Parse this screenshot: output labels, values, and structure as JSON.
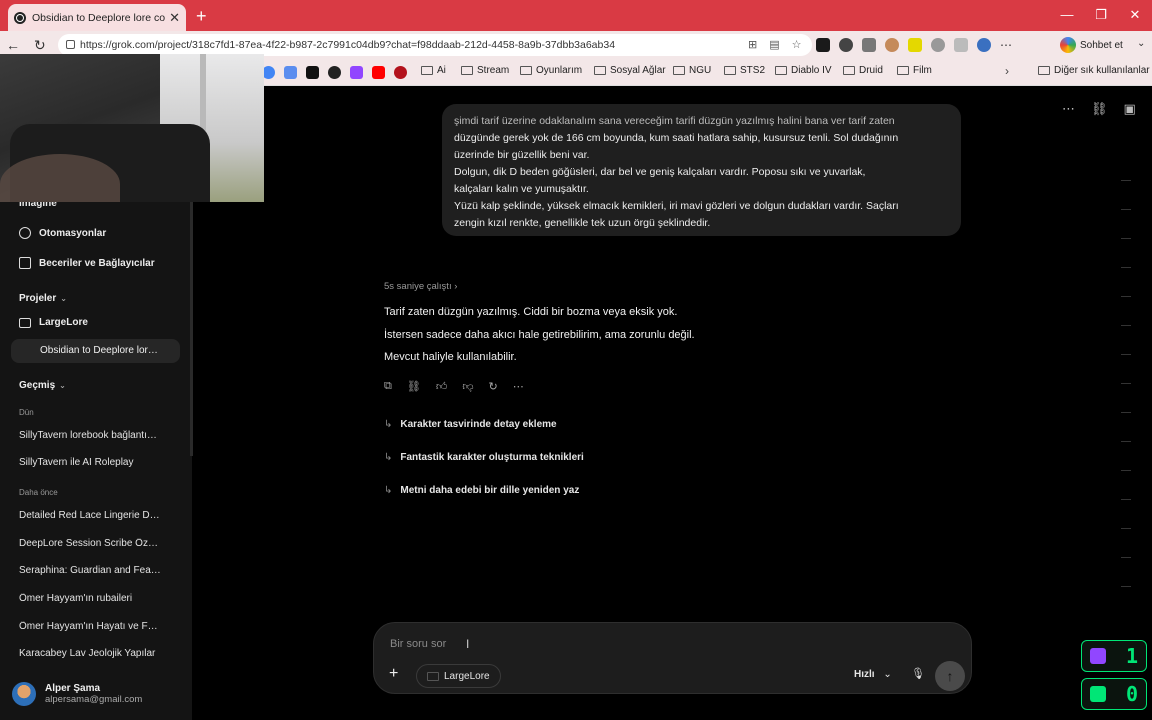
{
  "browser": {
    "tab_title": "Obsidian to Deeplore lore conversation",
    "url": "https://grok.com/project/318c7fd1-87ea-4f22-b987-2c7991c04db9?chat=f98ddaab-212d-4458-8a9b-37dbb3a6ab34",
    "sohbet_label": "Sohbet et",
    "bookmarks": [
      "Ai",
      "Stream",
      "Oyunlarım",
      "Sosyal Ağlar",
      "NGU",
      "STS2",
      "Diablo IV",
      "Druid",
      "Film"
    ],
    "other_bookmarks": "Diğer sık kullanılanlar"
  },
  "sidebar": {
    "imagine": "Imagine",
    "automations": "Otomasyonlar",
    "skills": "Beceriler ve Bağlayıcılar",
    "projects_title": "Projeler",
    "project_name": "LargeLore",
    "active_chat": "Obsidian to Deeplore lor…",
    "history_title": "Geçmiş",
    "yesterday": "Dün",
    "yesterday_items": [
      "SillyTavern lorebook bağlantı…",
      "SillyTavern ile AI Roleplay"
    ],
    "earlier": "Daha önce",
    "earlier_items": [
      "Detailed Red Lace Lingerie D…",
      "DeepLore Session Scribe Öz…",
      "Seraphina: Guardian and Fea…",
      "Ömer Hayyam'ın rubaileri",
      "Ömer Hayyam'ın Hayatı ve F…",
      "Karacabey Lav Jeolojik Yapılar"
    ],
    "user_name": "Alper Şama",
    "user_email": "alpersama@gmail.com"
  },
  "chat": {
    "user_message": [
      "şimdi tarif üzerine odaklanalım sana vereceğim tarifi düzgün yazılmış halini bana ver tarif zaten",
      "düzgünde gerek yok de 166 cm boyunda, kum saati hatlara sahip, kusursuz tenli. Sol dudağının",
      "üzerinde bir güzellik beni var.",
      "Dolgun, dik D beden göğüsleri, dar bel ve geniş kalçaları vardır. Poposu sıkı ve yuvarlak,",
      "kalçaları kalın ve yumuşaktır.",
      "Yüzü kalp şeklinde, yüksek elmacık kemikleri, iri mavi gözleri ve dolgun dudakları vardır. Saçları",
      "zengin kızıl renkte, genellikle tek uzun örgü şeklindedir."
    ],
    "thinking_label": "5s saniye çalıştı",
    "answer_lines": [
      "Tarif zaten düzgün yazılmış. Ciddi bir bozma veya eksik yok.",
      "İstersen sadece daha akıcı hale getirebilirim, ama zorunlu değil.",
      "Mevcut haliyle kullanılabilir."
    ],
    "suggestions": [
      "Karakter tasvirinde detay ekleme",
      "Fantastik karakter oluşturma teknikleri",
      "Metni daha edebi bir dille yeniden yaz"
    ]
  },
  "composer": {
    "placeholder": "Bir soru sor",
    "project_chip": "LargeLore",
    "mode": "Hızlı"
  },
  "overlay": {
    "twitch_count": "1",
    "kick_count": "0"
  },
  "colors": {
    "titlebar": "#d93a44",
    "background": "#000000",
    "sidebar": "#141414",
    "overlay_green": "#00e676",
    "twitch_purple": "#9146ff"
  }
}
